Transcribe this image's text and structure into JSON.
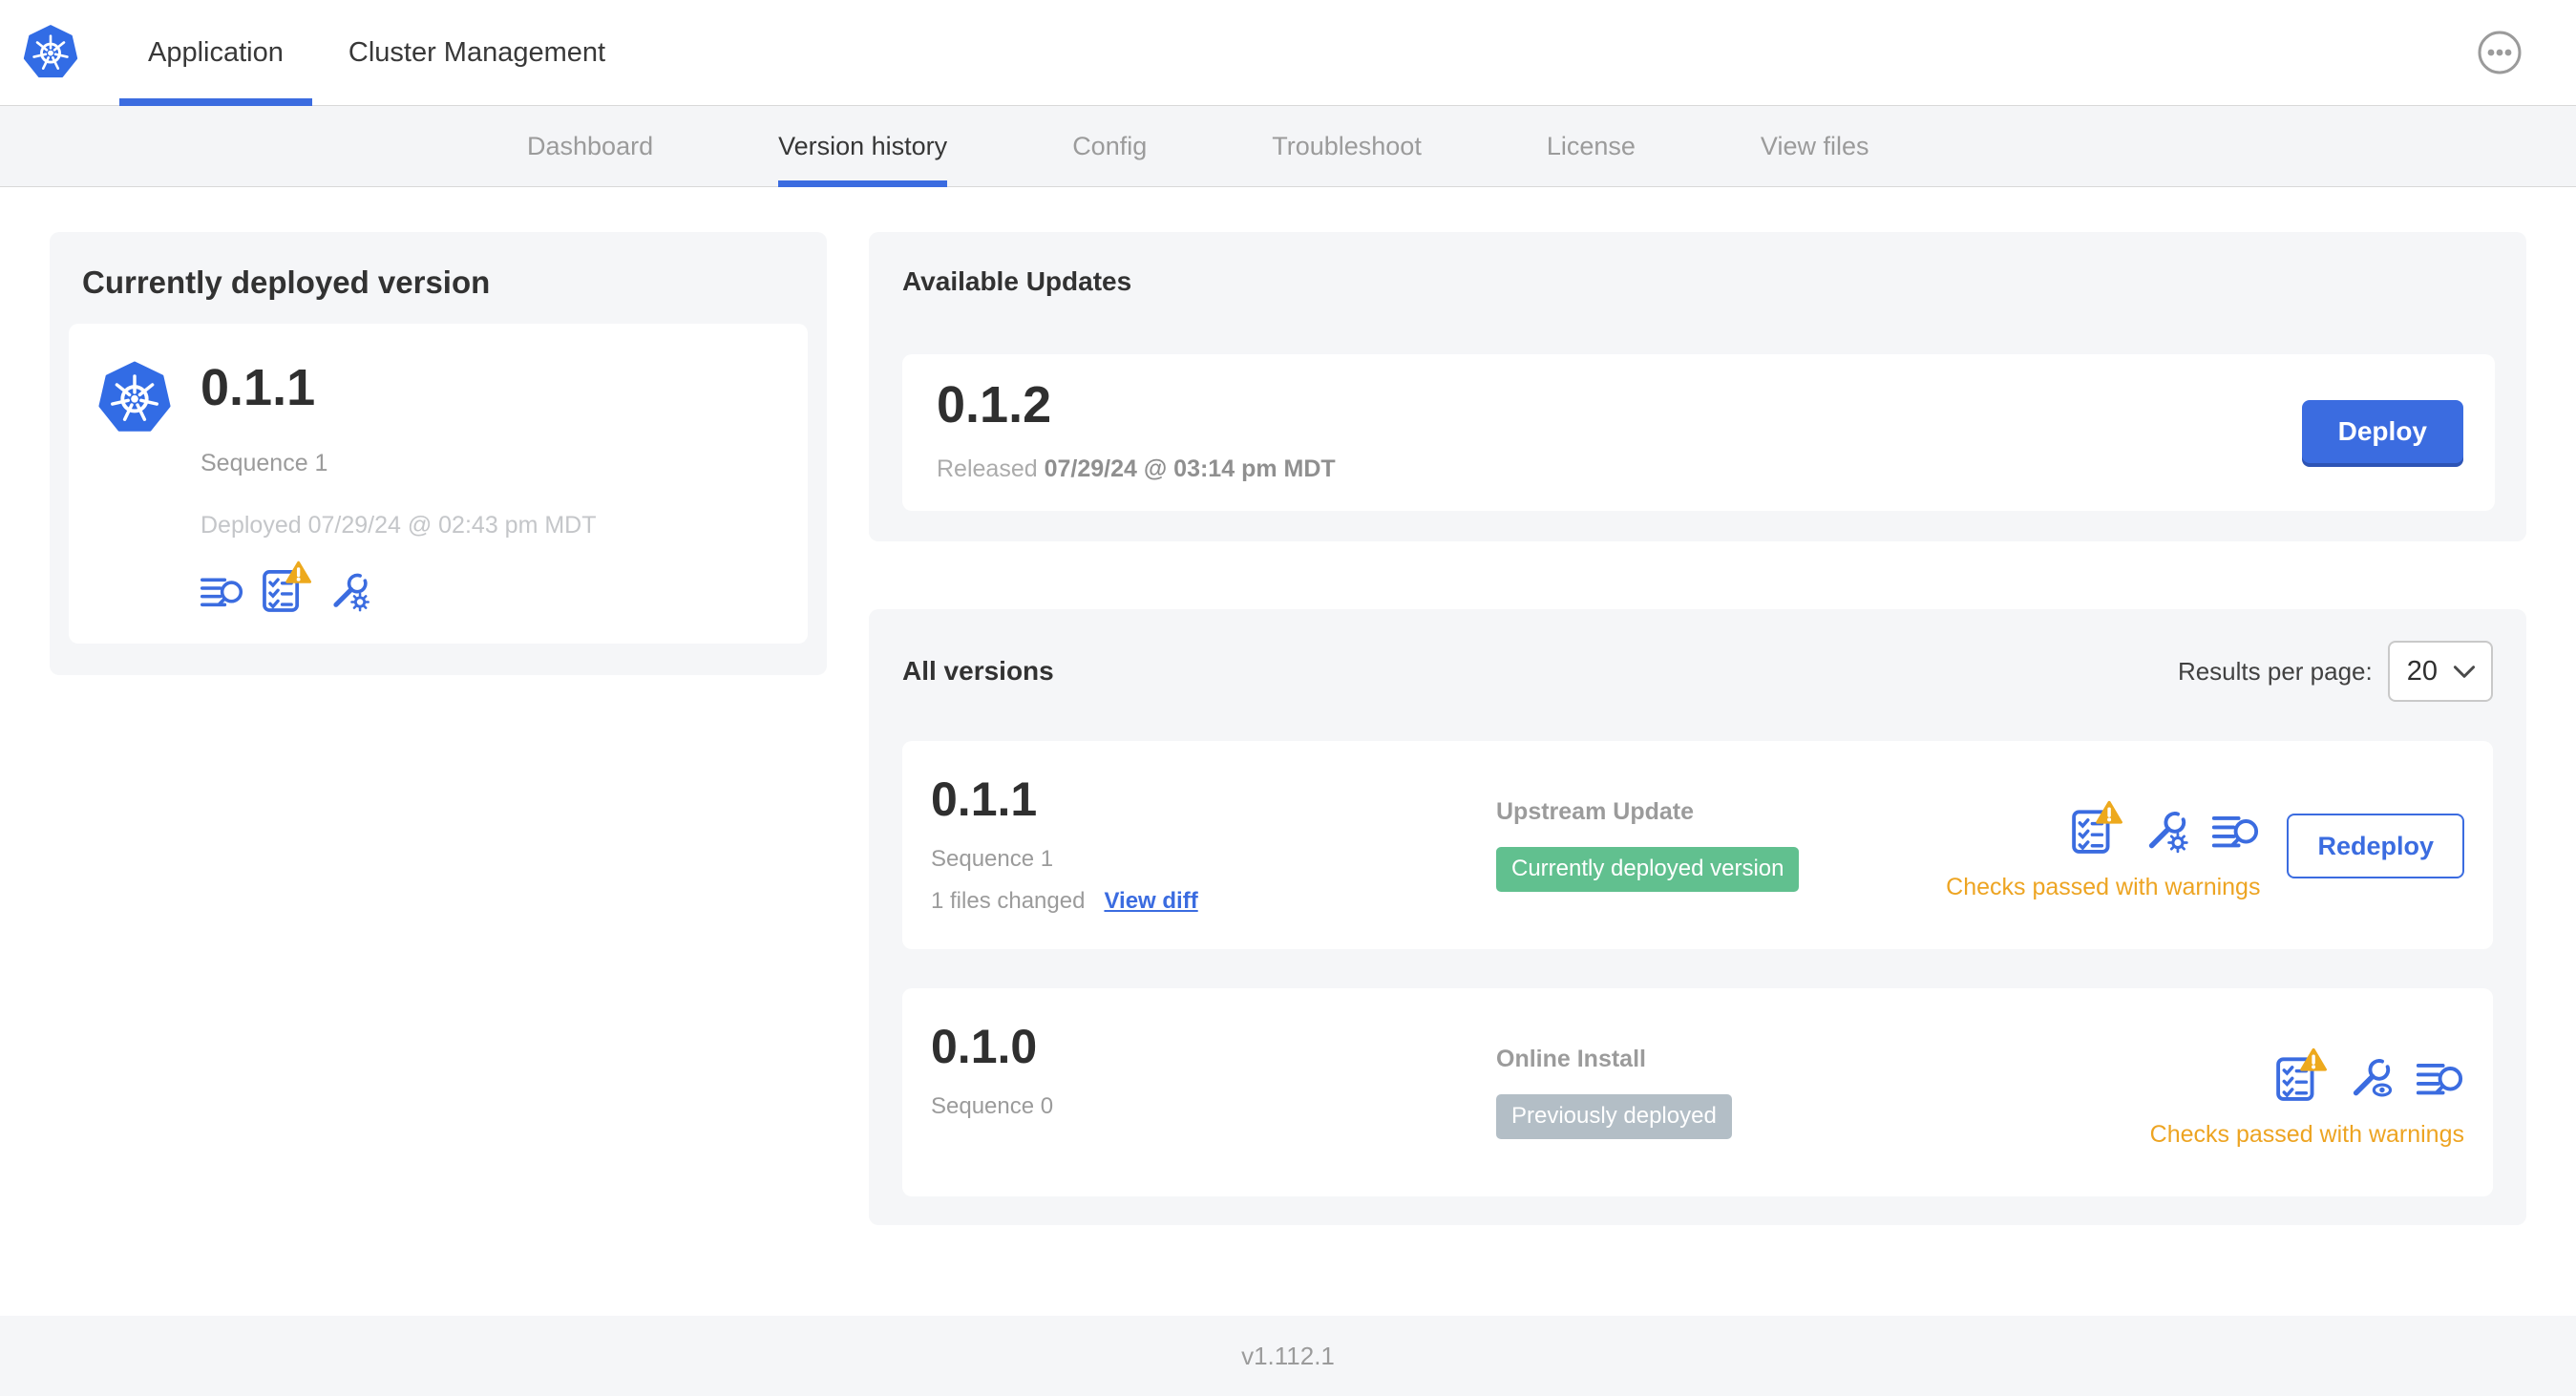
{
  "colors": {
    "accent_blue": "#3b6ce0",
    "kubernetes_blue": "#326ce5",
    "green_badge": "#61c08f",
    "gray_badge": "#b3bec6",
    "warning_orange": "#eda422",
    "card_background": "#f5f6f8"
  },
  "header": {
    "tabs": [
      {
        "label": "Application",
        "active": true
      },
      {
        "label": "Cluster Management",
        "active": false
      }
    ]
  },
  "subnav": {
    "tabs": [
      {
        "label": "Dashboard",
        "active": false
      },
      {
        "label": "Version history",
        "active": true
      },
      {
        "label": "Config",
        "active": false
      },
      {
        "label": "Troubleshoot",
        "active": false
      },
      {
        "label": "License",
        "active": false
      },
      {
        "label": "View files",
        "active": false
      }
    ]
  },
  "deployed_card": {
    "title": "Currently deployed version",
    "version": "0.1.1",
    "sequence": "Sequence 1",
    "deployed": "Deployed 07/29/24 @ 02:43 pm MDT"
  },
  "available_updates": {
    "title": "Available Updates",
    "version": "0.1.2",
    "released_prefix": "Released",
    "released_date": "07/29/24 @ 03:14 pm MDT",
    "deploy_label": "Deploy"
  },
  "all_versions": {
    "title": "All versions",
    "results_per_page_label": "Results per page:",
    "results_per_page_value": "20",
    "rows": [
      {
        "version": "0.1.1",
        "sequence": "Sequence 1",
        "files_changed": "1 files changed",
        "view_diff": "View diff",
        "source": "Upstream Update",
        "badge": "Currently deployed version",
        "checks": "Checks passed with warnings",
        "action": "Redeploy"
      },
      {
        "version": "0.1.0",
        "sequence": "Sequence 0",
        "source": "Online Install",
        "badge": "Previously deployed",
        "checks": "Checks passed with warnings"
      }
    ]
  },
  "footer": {
    "app_version": "v1.112.1"
  }
}
